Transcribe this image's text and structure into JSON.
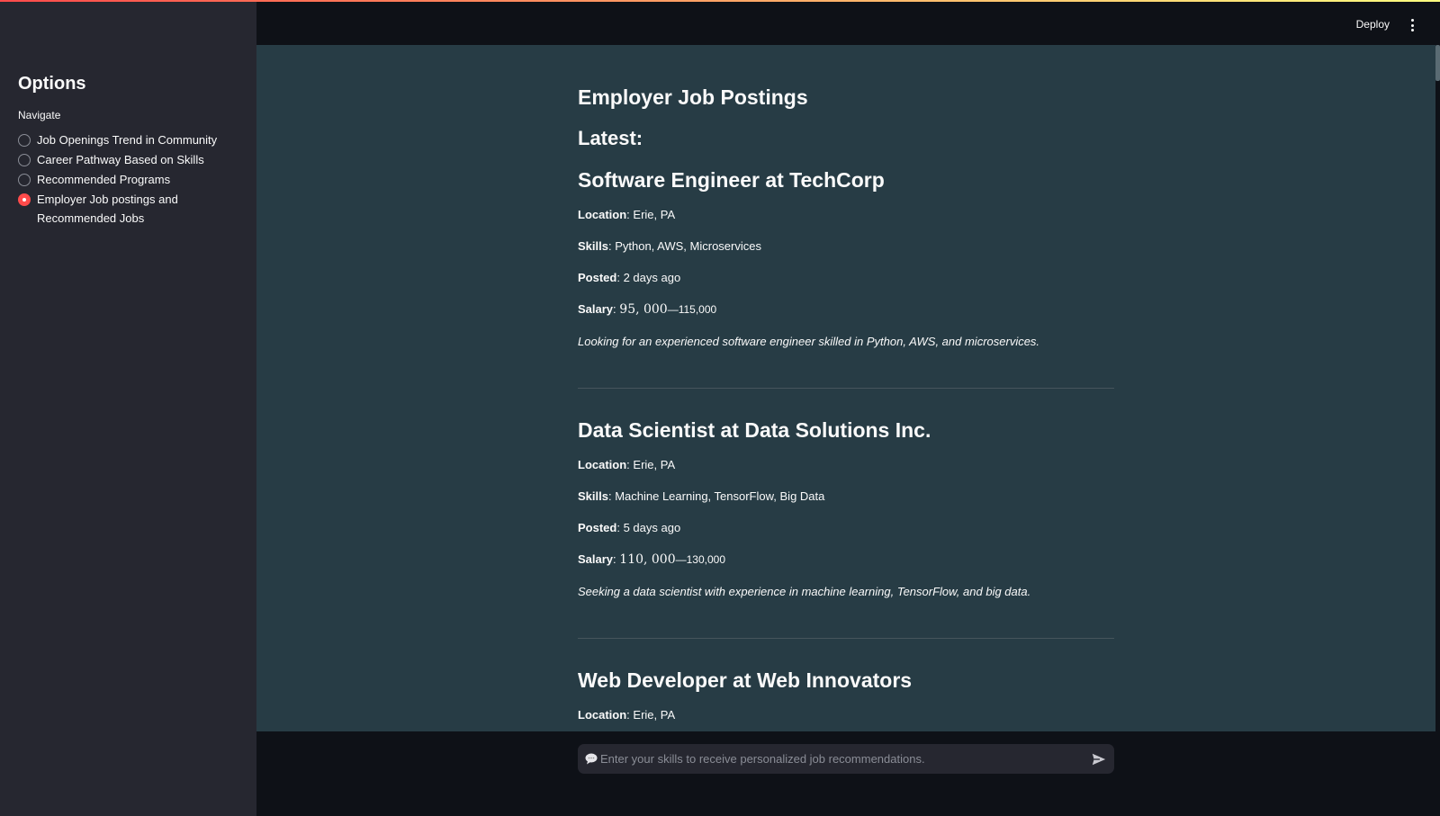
{
  "sidebar": {
    "title": "Options",
    "nav_label": "Navigate",
    "items": [
      {
        "label": "Job Openings Trend in Community",
        "selected": false
      },
      {
        "label": "Career Pathway Based on Skills",
        "selected": false
      },
      {
        "label": "Recommended Programs",
        "selected": false
      },
      {
        "label": "Employer Job postings and Recommended Jobs",
        "selected": true
      }
    ]
  },
  "header": {
    "deploy_label": "Deploy",
    "menu_icon": "kebab-menu-icon"
  },
  "main": {
    "title": "Employer Job Postings",
    "latest_label": "Latest:",
    "field_labels": {
      "location": "Location",
      "skills": "Skills",
      "posted": "Posted",
      "salary": "Salary"
    },
    "jobs": [
      {
        "title": "Software Engineer at TechCorp",
        "location": "Erie, PA",
        "skills": "Python, AWS, Microservices",
        "posted": "2 days ago",
        "salary_main": "95, 000",
        "salary_sub": "—115,000",
        "description": "Looking for an experienced software engineer skilled in Python, AWS, and microservices."
      },
      {
        "title": "Data Scientist at Data Solutions Inc.",
        "location": "Erie, PA",
        "skills": "Machine Learning, TensorFlow, Big Data",
        "posted": "5 days ago",
        "salary_main": "110, 000",
        "salary_sub": "—130,000",
        "description": "Seeking a data scientist with experience in machine learning, TensorFlow, and big data."
      },
      {
        "title": "Web Developer at Web Innovators",
        "location": "Erie, PA"
      }
    ]
  },
  "chat": {
    "placeholder": "Enter your skills to receive personalized job recommendations.",
    "icon": "speech-bubble-icon",
    "send_icon": "send-icon"
  },
  "colors": {
    "accent": "#ff4b4b",
    "main_bg": "#273c45",
    "sidebar_bg": "#262730",
    "app_bg": "#0e1117"
  }
}
